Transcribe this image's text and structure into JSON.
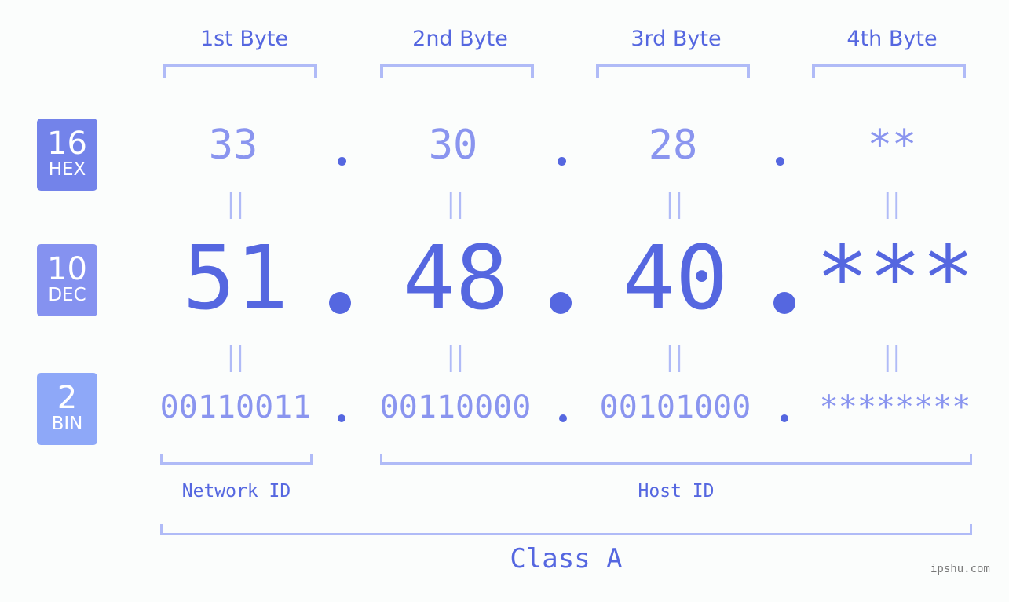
{
  "bytes": [
    {
      "header": "1st Byte",
      "hex": "33",
      "dec": "51",
      "bin": "00110011"
    },
    {
      "header": "2nd Byte",
      "hex": "30",
      "dec": "48",
      "bin": "00110000"
    },
    {
      "header": "3rd Byte",
      "hex": "28",
      "dec": "40",
      "bin": "00101000"
    },
    {
      "header": "4th Byte",
      "hex": "**",
      "dec": "***",
      "bin": "********"
    }
  ],
  "badges": {
    "hex": {
      "num": "16",
      "label": "HEX",
      "color": "#7383ea"
    },
    "dec": {
      "num": "10",
      "label": "DEC",
      "color": "#8592f0"
    },
    "bin": {
      "num": "2",
      "label": "BIN",
      "color": "#8ea8f8"
    }
  },
  "equals_sign": "||",
  "network_label": "Network ID",
  "host_label": "Host ID",
  "class_label": "Class A",
  "watermark": "ipshu.com"
}
